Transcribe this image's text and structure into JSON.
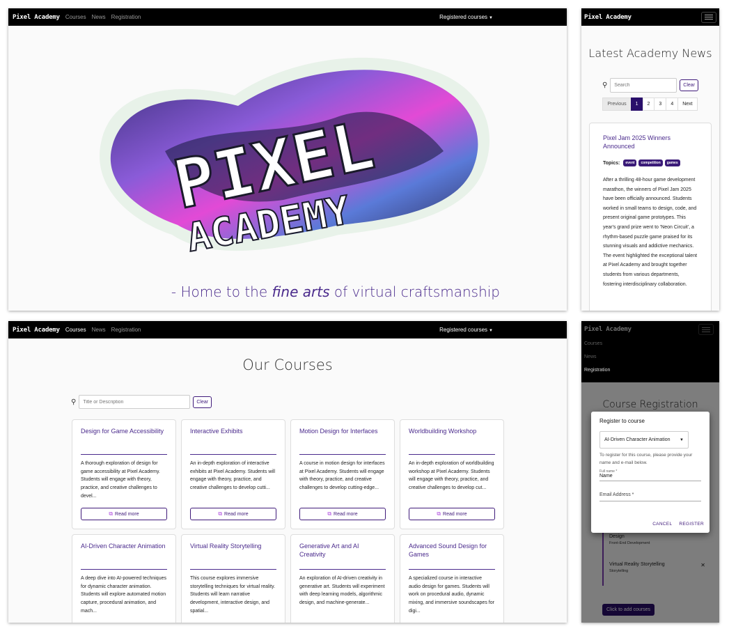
{
  "nav": {
    "brand": "Pixel Academy",
    "links": [
      "Courses",
      "News",
      "Registration"
    ],
    "right": "Registered courses"
  },
  "hero": {
    "logo_line1": "PIXEL",
    "logo_line2": "ACADEMY",
    "tagline_prefix": "- Home to the ",
    "tagline_em": "fine arts",
    "tagline_suffix": " of virtual craftsmanship"
  },
  "news": {
    "title": "Latest Academy News",
    "search_placeholder": "Search",
    "clear_label": "Clear",
    "pagination": [
      "Previous",
      "1",
      "2",
      "3",
      "4",
      "Next"
    ],
    "active_page": "1",
    "article": {
      "title": "Pixel Jam 2025 Winners Announced",
      "topics_label": "Topics:",
      "tags": [
        "event",
        "competition",
        "games"
      ],
      "body": "After a thrilling 48-hour game development marathon, the winners of Pixel Jam 2025 have been officially announced. Students worked in small teams to design, code, and present original game prototypes. This year's grand prize went to 'Neon Circuit', a rhythm-based puzzle game praised for its stunning visuals and addictive mechanics. The event highlighted the exceptional talent at Pixel Academy and brought together students from various departments, fostering interdisciplinary collaboration."
    }
  },
  "courses": {
    "title": "Our Courses",
    "search_placeholder": "Title or Description",
    "clear_label": "Clear",
    "read_more": "Read more",
    "items": [
      {
        "title": "Design for Game Accessibility",
        "desc": "A thorough exploration of design for game accessibility at Pixel Academy. Students will engage with theory, practice, and creative challenges to devel..."
      },
      {
        "title": "Interactive Exhibits",
        "desc": "An in-depth exploration of interactive exhibits at Pixel Academy. Students will engage with theory, practice, and creative challenges to develop cutti..."
      },
      {
        "title": "Motion Design for Interfaces",
        "desc": "A course in motion design for interfaces at Pixel Academy. Students will engage with theory, practice, and creative challenges to develop cutting-edge..."
      },
      {
        "title": "Worldbuilding Workshop",
        "desc": "An in-depth exploration of worldbuilding workshop at Pixel Academy. Students will engage with theory, practice, and creative challenges to develop cut..."
      },
      {
        "title": "AI-Driven Character Animation",
        "desc": "A deep dive into AI-powered techniques for dynamic character animation. Students will explore automated motion capture, procedural animation, and mach..."
      },
      {
        "title": "Virtual Reality Storytelling",
        "desc": "This course explores immersive storytelling techniques for virtual reality. Students will learn narrative development, interactive design, and spatial..."
      },
      {
        "title": "Generative Art and AI Creativity",
        "desc": "An exploration of AI-driven creativity in generative art. Students will experiment with deep learning models, algorithmic design, and machine-generate..."
      },
      {
        "title": "Advanced Sound Design for Games",
        "desc": "A specialized course in interactive audio design for games. Students will work on procedural audio, dynamic mixing, and immersive soundscapes for digi..."
      }
    ]
  },
  "registration": {
    "title": "Course Registration",
    "dialog_title": "Register to course",
    "selected_course": "AI-Driven Character Animation",
    "help": "To register for this course, please provide your name and e-mail below.",
    "fullname_label": "Full name *",
    "fullname_value": "Name",
    "email_label": "Email Address *",
    "cancel": "CANCEL",
    "register": "REGISTER",
    "registered": [
      {
        "title": "Design",
        "subtitle": "Front-End Development"
      },
      {
        "title": "Virtual Reality Storytelling",
        "subtitle": "Storytelling"
      }
    ],
    "add_button": "Click to add courses"
  },
  "colors": {
    "accent": "#2a0f6b",
    "link": "#4a2a8c",
    "navbar": "#000000"
  }
}
